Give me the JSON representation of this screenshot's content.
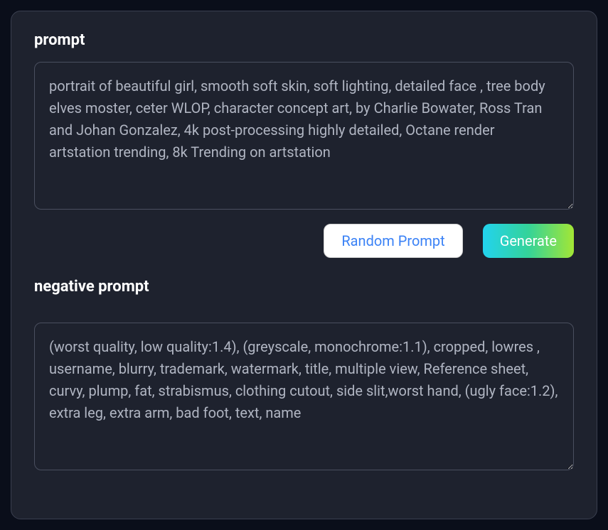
{
  "prompt": {
    "label": "prompt",
    "value": "portrait of beautiful girl, smooth soft skin, soft lighting, detailed face , tree body elves moster, ceter WLOP, character concept art, by Charlie Bowater, Ross Tran and Johan Gonzalez, 4k post-processing highly detailed, Octane render artstation trending, 8k Trending on artstation"
  },
  "buttons": {
    "random_label": "Random Prompt",
    "generate_label": "Generate"
  },
  "negative_prompt": {
    "label": "negative prompt",
    "value": "(worst quality, low quality:1.4), (greyscale, monochrome:1.1), cropped, lowres , username, blurry, trademark, watermark, title, multiple view, Reference sheet, curvy, plump, fat, strabismus, clothing cutout, side slit,worst hand, (ugly face:1.2), extra leg, extra arm, bad foot, text, name"
  }
}
